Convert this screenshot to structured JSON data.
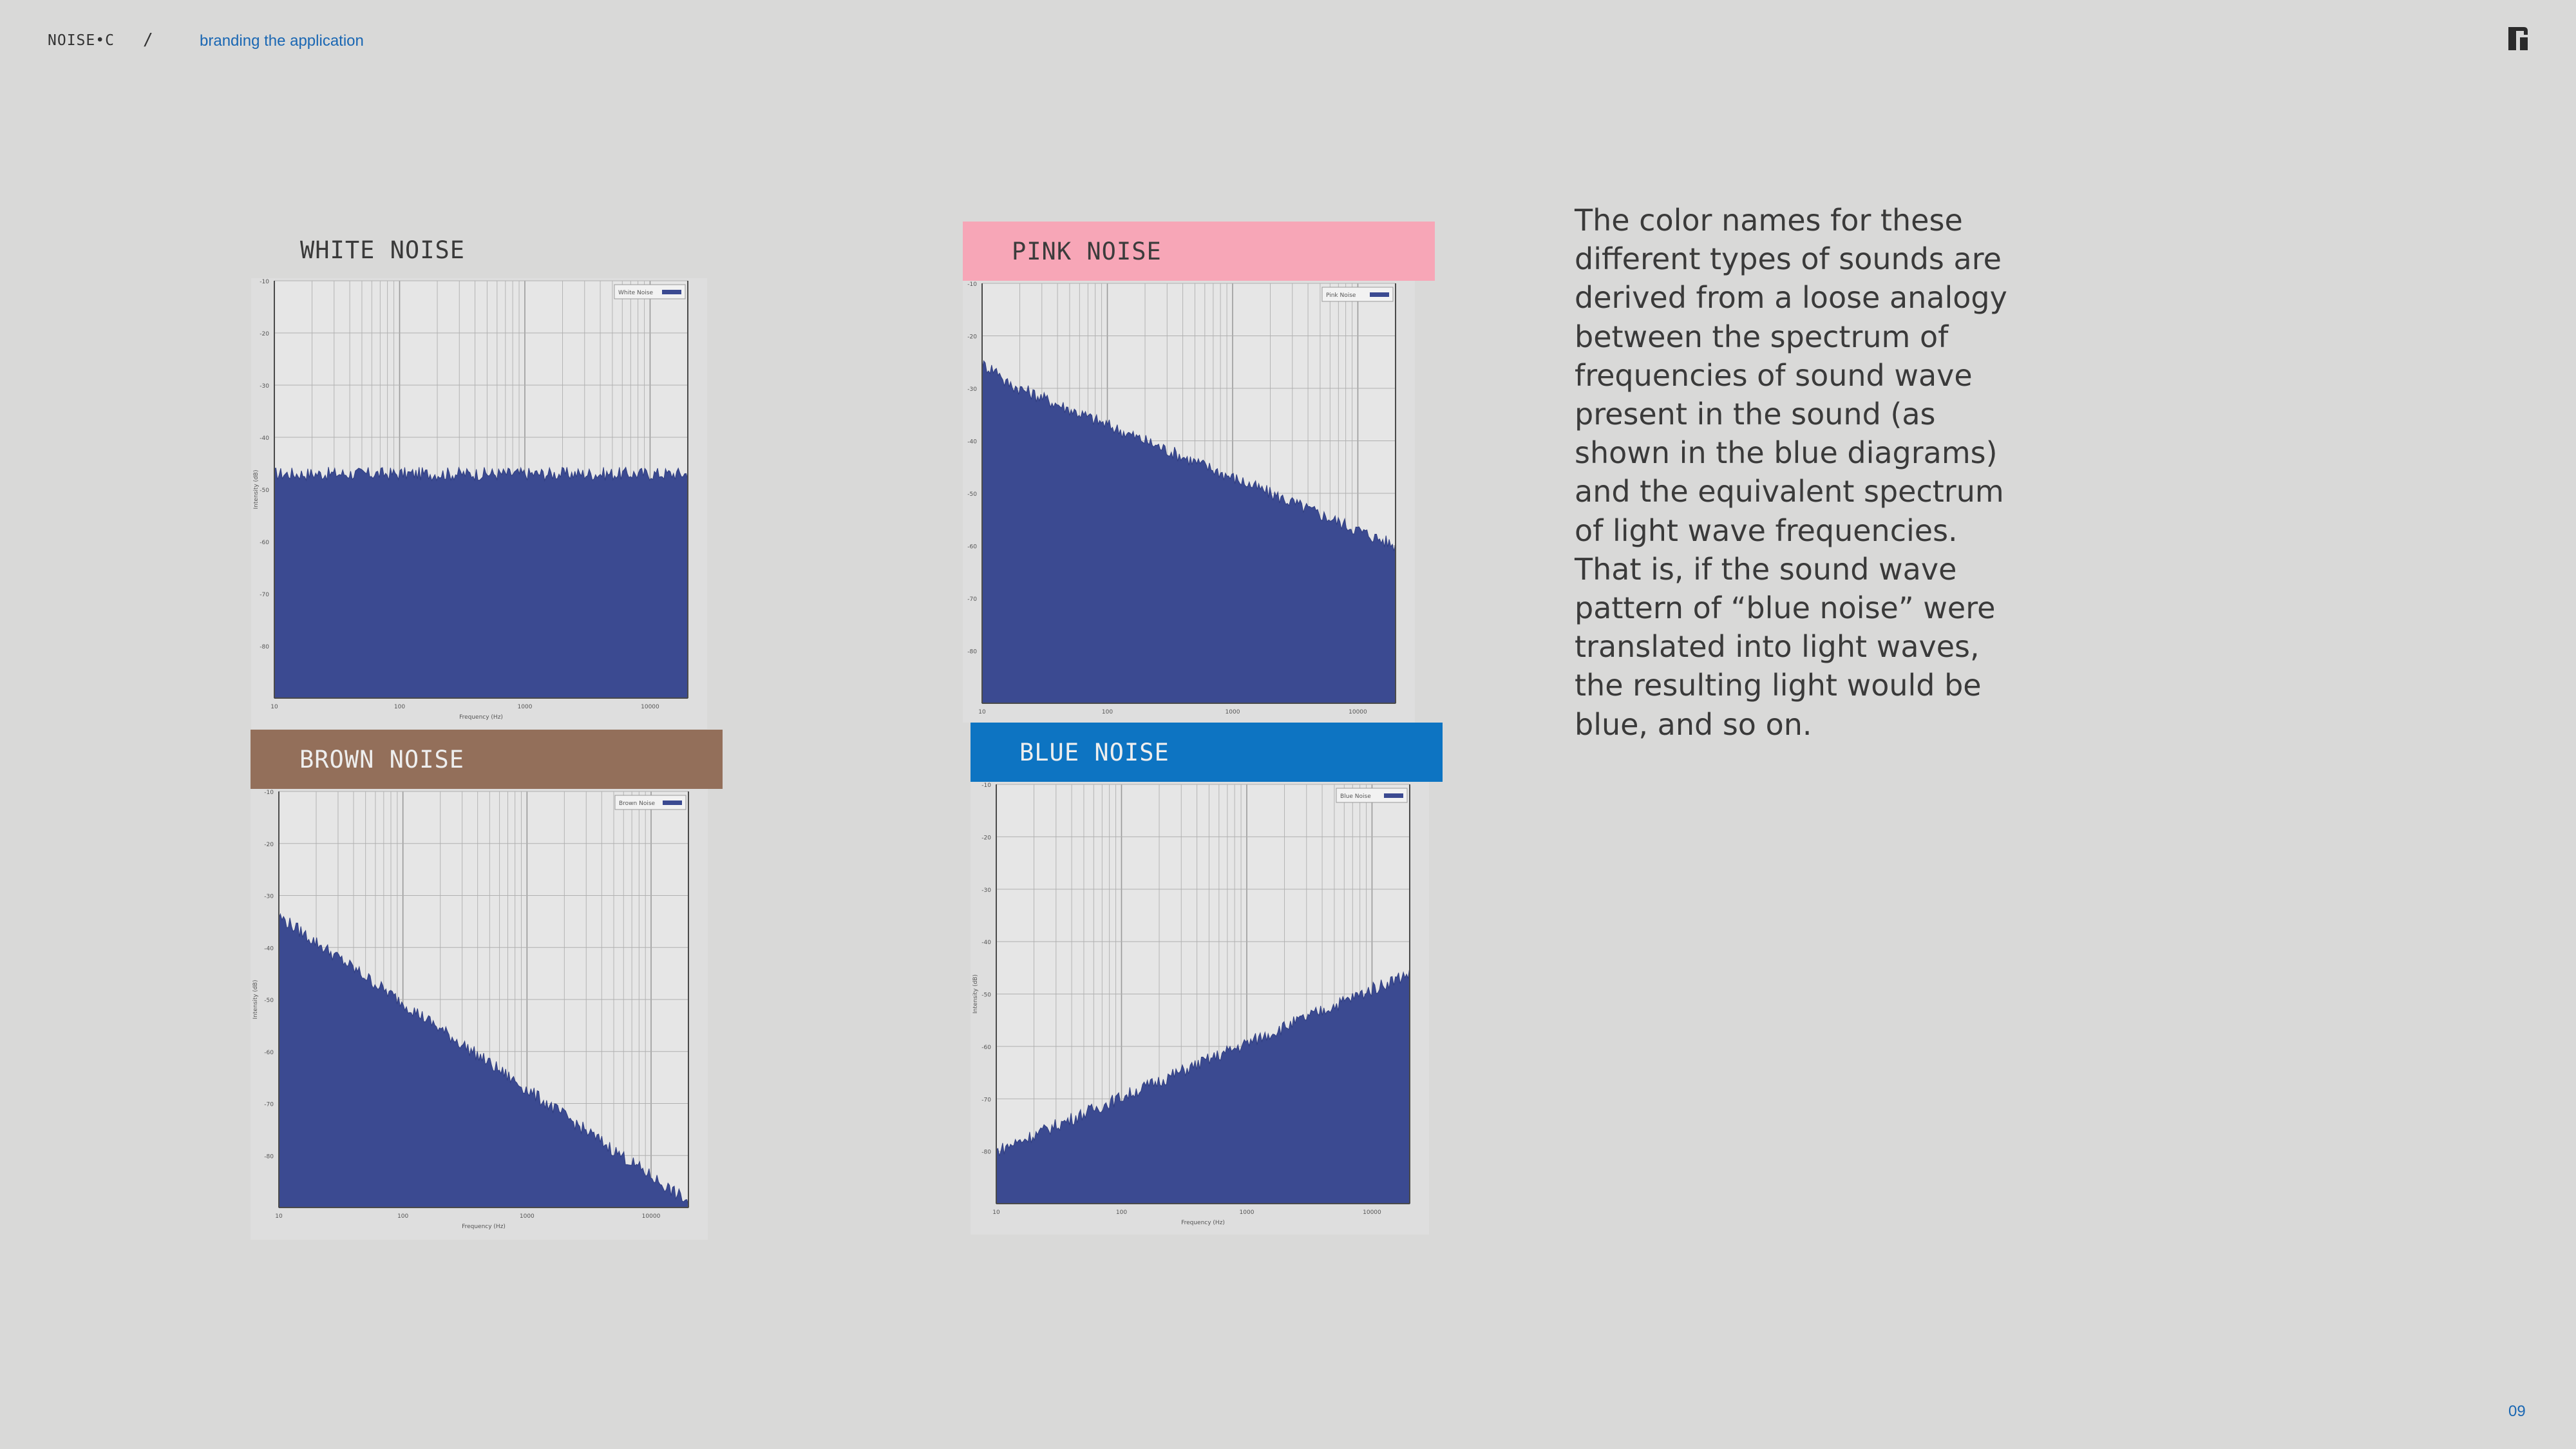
{
  "header": {
    "brand": "NOISE•C",
    "separator": "/",
    "breadcrumb": "branding the application"
  },
  "page_number": "09",
  "body_text": "The color names for these different types of sounds are derived from a loose analogy between the spectrum of frequencies of sound wave present in the sound (as shown in the blue diagrams) and the equivalent spectrum of light wave frequencies. That is, if the sound wave pattern of “blue noise” were translated into light waves, the resulting light would be blue, and so on.",
  "labels": {
    "white": "WHITE NOISE",
    "pink": "PINK NOISE",
    "brown": "BROWN NOISE",
    "blue": "BLUE NOISE"
  },
  "colors": {
    "background": "#d9d9d8",
    "pink_label": "#f7a6b7",
    "brown_label": "#936f5a",
    "blue_label": "#0d74c2",
    "spectrum_fill": "#3b4a91",
    "accent_text": "#1a67b3"
  },
  "chart_data": [
    {
      "type": "area",
      "legend": "White Noise",
      "xlabel": "Frequency (Hz)",
      "ylabel": "Intensity (dB)",
      "xscale": "log",
      "xlim": [
        10,
        20000
      ],
      "ylim": [
        -90,
        -10
      ],
      "x_ticks": [
        "10",
        "100",
        "1000",
        "10000"
      ],
      "y_ticks": [
        "-10",
        "-20",
        "-30",
        "-40",
        "-50",
        "-60",
        "-70",
        "-80"
      ],
      "grid": true,
      "series": [
        {
          "x": [
            10,
            20000
          ],
          "y": [
            -47,
            -47
          ]
        }
      ]
    },
    {
      "type": "area",
      "legend": "Pink Noise",
      "xlabel": "",
      "ylabel": "",
      "xscale": "log",
      "xlim": [
        10,
        20000
      ],
      "ylim": [
        -90,
        -10
      ],
      "x_ticks": [
        "10",
        "100",
        "1000",
        "10000"
      ],
      "y_ticks": [
        "-10",
        "-20",
        "-30",
        "-40",
        "-50",
        "-60",
        "-70",
        "-80"
      ],
      "grid": true,
      "series": [
        {
          "x": [
            10,
            20000
          ],
          "y": [
            -27,
            -60
          ]
        }
      ]
    },
    {
      "type": "area",
      "legend": "Brown Noise",
      "xlabel": "Frequency (Hz)",
      "ylabel": "Intensity (dB)",
      "xscale": "log",
      "xlim": [
        10,
        20000
      ],
      "ylim": [
        -90,
        -10
      ],
      "x_ticks": [
        "10",
        "100",
        "1000",
        "10000"
      ],
      "y_ticks": [
        "-10",
        "-20",
        "-30",
        "-40",
        "-50",
        "-60",
        "-70",
        "-80"
      ],
      "grid": true,
      "series": [
        {
          "x": [
            10,
            20000
          ],
          "y": [
            -34,
            -89
          ]
        }
      ]
    },
    {
      "type": "area",
      "legend": "Blue Noise",
      "xlabel": "Frequency (Hz)",
      "ylabel": "Intensity (dB)",
      "xscale": "log",
      "xlim": [
        10,
        20000
      ],
      "ylim": [
        -90,
        -10
      ],
      "x_ticks": [
        "10",
        "100",
        "1000",
        "10000"
      ],
      "y_ticks": [
        "-10",
        "-20",
        "-30",
        "-40",
        "-50",
        "-60",
        "-70",
        "-80"
      ],
      "grid": true,
      "series": [
        {
          "x": [
            10,
            20000
          ],
          "y": [
            -80,
            -46
          ]
        }
      ]
    }
  ]
}
